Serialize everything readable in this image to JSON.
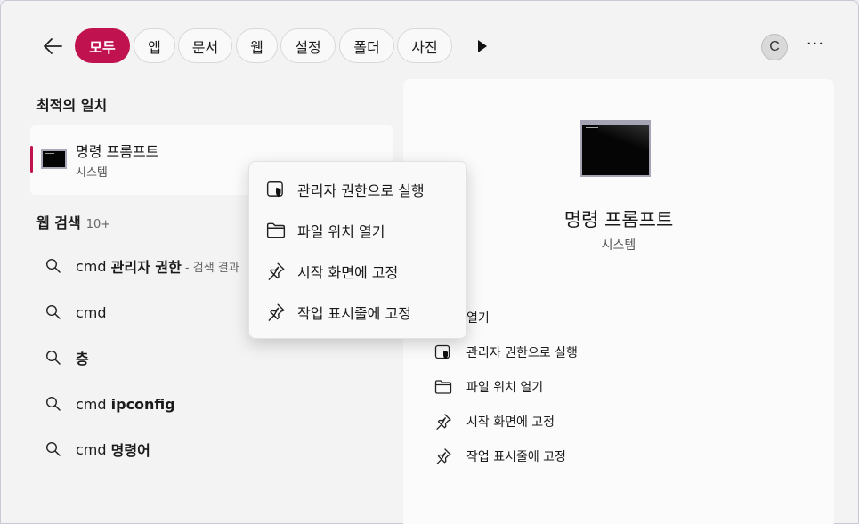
{
  "filters": {
    "tabs": [
      "모두",
      "앱",
      "문서",
      "웹",
      "설정",
      "폴더",
      "사진"
    ],
    "active_index": 0
  },
  "user": {
    "avatar_letter": "C"
  },
  "more_options_label": "···",
  "best_match": {
    "heading": "최적의 일치",
    "title": "명령 프롬프트",
    "subtitle": "시스템"
  },
  "web_search": {
    "heading": "웹 검색",
    "count": "10+",
    "results": [
      {
        "prefix": "cmd ",
        "bold": "관리자 권한",
        "hint": " - 검색 결과"
      },
      {
        "prefix": "cmd",
        "bold": "",
        "hint": ""
      },
      {
        "prefix": "",
        "bold": "층",
        "hint": ""
      },
      {
        "prefix": "cmd ",
        "bold": "ipconfig",
        "hint": ""
      },
      {
        "prefix": "cmd ",
        "bold": "명령어",
        "hint": ""
      }
    ]
  },
  "detail": {
    "title": "명령 프롬프트",
    "subtitle": "시스템",
    "actions": [
      "열기",
      "관리자 권한으로 실행",
      "파일 위치 열기",
      "시작 화면에 고정",
      "작업 표시줄에 고정"
    ]
  },
  "context_menu": {
    "items": [
      "관리자 권한으로 실행",
      "파일 위치 열기",
      "시작 화면에 고정",
      "작업 표시줄에 고정"
    ]
  },
  "colors": {
    "accent": "#c0124e",
    "background": "#f3f3f3",
    "panel": "#fbfbfb"
  }
}
